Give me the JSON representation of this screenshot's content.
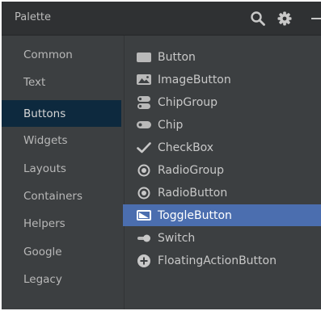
{
  "header": {
    "title": "Palette",
    "icons": [
      "search-icon",
      "gear-icon",
      "minimize-icon"
    ]
  },
  "sidebar": {
    "categories": [
      {
        "label": "Common",
        "selected": false
      },
      {
        "label": "Text",
        "selected": false
      },
      {
        "label": "Buttons",
        "selected": true
      },
      {
        "label": "Widgets",
        "selected": false
      },
      {
        "label": "Layouts",
        "selected": false
      },
      {
        "label": "Containers",
        "selected": false
      },
      {
        "label": "Helpers",
        "selected": false
      },
      {
        "label": "Google",
        "selected": false
      },
      {
        "label": "Legacy",
        "selected": false
      }
    ]
  },
  "items": [
    {
      "label": "Button",
      "icon": "button-icon",
      "selected": false
    },
    {
      "label": "ImageButton",
      "icon": "image-button-icon",
      "selected": false
    },
    {
      "label": "ChipGroup",
      "icon": "chip-group-icon",
      "selected": false
    },
    {
      "label": "Chip",
      "icon": "chip-icon",
      "selected": false
    },
    {
      "label": "CheckBox",
      "icon": "checkmark-icon",
      "selected": false
    },
    {
      "label": "RadioGroup",
      "icon": "radio-group-icon",
      "selected": false
    },
    {
      "label": "RadioButton",
      "icon": "radio-button-icon",
      "selected": false
    },
    {
      "label": "ToggleButton",
      "icon": "toggle-button-icon",
      "selected": true
    },
    {
      "label": "Switch",
      "icon": "switch-icon",
      "selected": false
    },
    {
      "label": "FloatingActionButton",
      "icon": "floating-action-button-icon",
      "selected": false
    }
  ],
  "colors": {
    "panel_bg": "#3c3f41",
    "header_bg": "#2f3133",
    "category_selected_bg": "#0d293e",
    "item_selected_bg": "#4b6eaf",
    "text": "#bbbbbb"
  }
}
